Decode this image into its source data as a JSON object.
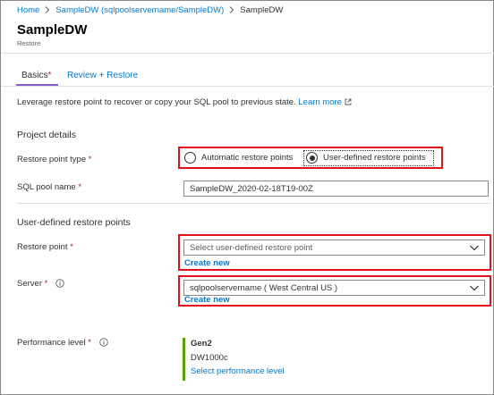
{
  "breadcrumb": {
    "items": [
      "Home",
      "SampleDW (sqlpoolservername/SampleDW)",
      "SampleDW"
    ]
  },
  "header": {
    "title": "SampleDW",
    "subtitle": "Restore"
  },
  "tabs": [
    {
      "label": "Basics",
      "required_marker": "*",
      "active": true
    },
    {
      "label": "Review + Restore",
      "active": false
    }
  ],
  "intro": {
    "text": "Leverage restore point to recover or copy your SQL pool to previous state.",
    "link": "Learn more"
  },
  "project_details": {
    "title": "Project details",
    "restore_point_type": {
      "label": "Restore point type",
      "required_marker": "*",
      "options": [
        "Automatic restore points",
        "User-defined restore points"
      ],
      "selected": "User-defined restore points"
    },
    "sql_pool_name": {
      "label": "SQL pool name",
      "required_marker": "*",
      "value": "SampleDW_2020-02-18T19-00Z"
    }
  },
  "user_defined": {
    "title": "User-defined restore points",
    "restore_point": {
      "label": "Restore point",
      "required_marker": "*",
      "placeholder": "Select user-defined restore point",
      "create_link": "Create new"
    },
    "server": {
      "label": "Server",
      "required_marker": "*",
      "value": "sqlpoolservername ( West Central US )",
      "create_link": "Create new"
    },
    "performance": {
      "label": "Performance level",
      "required_marker": "*",
      "tier": "Gen2",
      "level": "DW1000c",
      "link": "Select performance level"
    }
  },
  "colors": {
    "accent": "#0078d4",
    "highlight": "#e3101b",
    "required": "#a4262c",
    "tab_underline": "#8661c5",
    "performance_bar": "#57a300"
  },
  "icons": [
    "chevron-right-icon",
    "external-link-icon",
    "info-icon",
    "chevron-down-icon"
  ]
}
